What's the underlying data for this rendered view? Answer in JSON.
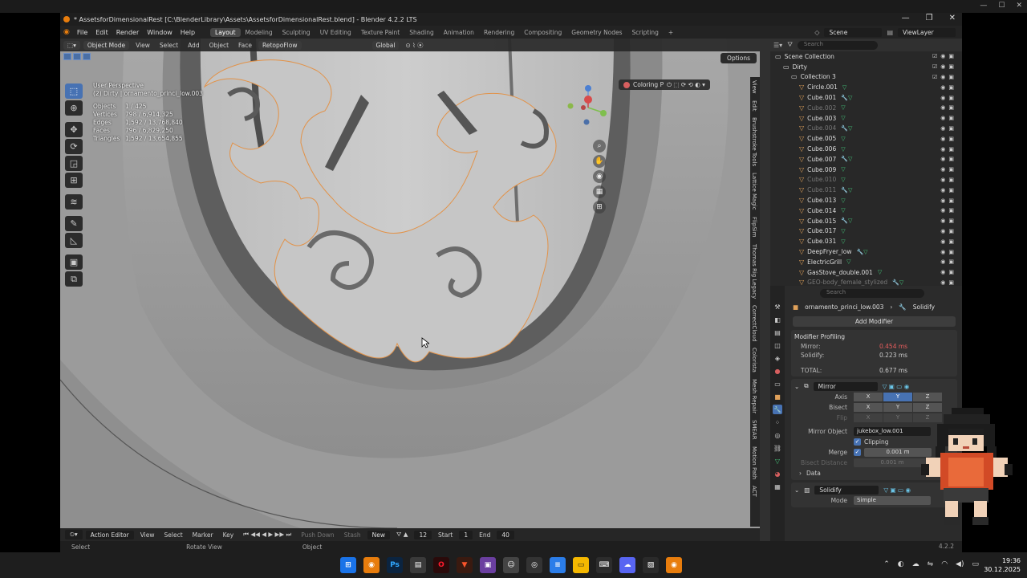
{
  "window": {
    "title": "* AssetsforDimensionalRest [C:\\BlenderLibrary\\Assets\\AssetsforDimensionalRest.blend] - Blender 4.2.2 LTS"
  },
  "menu": [
    "File",
    "Edit",
    "Render",
    "Window",
    "Help"
  ],
  "workspaces": [
    "Layout",
    "Modeling",
    "Sculpting",
    "UV Editing",
    "Texture Paint",
    "Shading",
    "Animation",
    "Rendering",
    "Compositing",
    "Geometry Nodes",
    "Scripting"
  ],
  "active_workspace": "Layout",
  "scene": {
    "label": "Scene",
    "view_layer": "ViewLayer"
  },
  "viewport": {
    "mode": "Object Mode",
    "menus": [
      "View",
      "Select",
      "Add",
      "Object",
      "Face",
      "RetopoFlow"
    ],
    "transform": "Global",
    "options": "Options",
    "coloring": "Coloring P",
    "view_name": "User Perspective",
    "object_name": "(2) Dirty | ornamento_princi_low.003",
    "stats": [
      {
        "k": "Objects",
        "v": "1 / 425"
      },
      {
        "k": "Vertices",
        "v": "798 / 6,914,325"
      },
      {
        "k": "Edges",
        "v": "1,592 / 13,768,840"
      },
      {
        "k": "Faces",
        "v": "796 / 6,829,250"
      },
      {
        "k": "Triangles",
        "v": "1,592 / 13,654,855"
      }
    ],
    "side_tabs": [
      "View",
      "Edit",
      "Brushstroke Tools",
      "Lattice Magic",
      "FlipSim",
      "Thomas Rig Legacy",
      "CorrectCloud",
      "Colorista",
      "Mesh Repair",
      "SMEAR",
      "Motion Path",
      "ACT"
    ]
  },
  "timeline": {
    "editor": "Action Editor",
    "menus": [
      "View",
      "Select",
      "Marker",
      "Key"
    ],
    "push_down": "Push Down",
    "stash": "Stash",
    "new_label": "New",
    "frame": "12",
    "start_label": "Start",
    "start": "1",
    "end_label": "End",
    "end": "40"
  },
  "statusbar": {
    "select": "Select",
    "rotate": "Rotate View",
    "object": "Object",
    "version": "4.2.2"
  },
  "outliner": {
    "search_placeholder": "Search",
    "items": [
      {
        "label": "Scene Collection",
        "dim": false
      },
      {
        "label": "Dirty",
        "dim": false
      },
      {
        "label": "Collection 3",
        "dim": false
      },
      {
        "label": "Circle.001",
        "dim": false
      },
      {
        "label": "Cube.001",
        "dim": false
      },
      {
        "label": "Cube.002",
        "dim": true
      },
      {
        "label": "Cube.003",
        "dim": false
      },
      {
        "label": "Cube.004",
        "dim": true
      },
      {
        "label": "Cube.005",
        "dim": false
      },
      {
        "label": "Cube.006",
        "dim": false
      },
      {
        "label": "Cube.007",
        "dim": false
      },
      {
        "label": "Cube.009",
        "dim": false
      },
      {
        "label": "Cube.010",
        "dim": true
      },
      {
        "label": "Cube.011",
        "dim": true
      },
      {
        "label": "Cube.013",
        "dim": false
      },
      {
        "label": "Cube.014",
        "dim": false
      },
      {
        "label": "Cube.015",
        "dim": false
      },
      {
        "label": "Cube.017",
        "dim": false
      },
      {
        "label": "Cube.031",
        "dim": false
      },
      {
        "label": "DeepFryer_low",
        "dim": false
      },
      {
        "label": "ElectricGrill",
        "dim": false
      },
      {
        "label": "GasStove_double.001",
        "dim": false
      },
      {
        "label": "GEO-body_female_stylized",
        "dim": true
      }
    ]
  },
  "properties": {
    "search_placeholder": "Search",
    "object": "ornamento_princi_low.003",
    "modifier_crumb": "Solidify",
    "add_modifier": "Add Modifier",
    "profiling": {
      "title": "Modifier Profiling",
      "rows": [
        {
          "k": "Mirror:",
          "v": "0.454 ms",
          "red": true
        },
        {
          "k": "Solidify:",
          "v": "0.223 ms",
          "red": false
        },
        {
          "k": "TOTAL:",
          "v": "0.677 ms",
          "red": false
        }
      ]
    },
    "mirror": {
      "name": "Mirror",
      "axis_label": "Axis",
      "bisect_label": "Bisect",
      "flip_label": "Flip",
      "mirror_object_label": "Mirror Object",
      "mirror_object": "jukebox_low.001",
      "clipping": "Clipping",
      "merge_label": "Merge",
      "merge_value": "0.001 m",
      "bisect_distance_label": "Bisect Distance",
      "bisect_distance": "0.001 m",
      "data_label": "Data"
    },
    "solidify": {
      "name": "Solidify",
      "mode_label": "Mode",
      "mode": "Simple"
    }
  },
  "taskbar": {
    "time": "19:36",
    "date": "30.12.2025"
  }
}
